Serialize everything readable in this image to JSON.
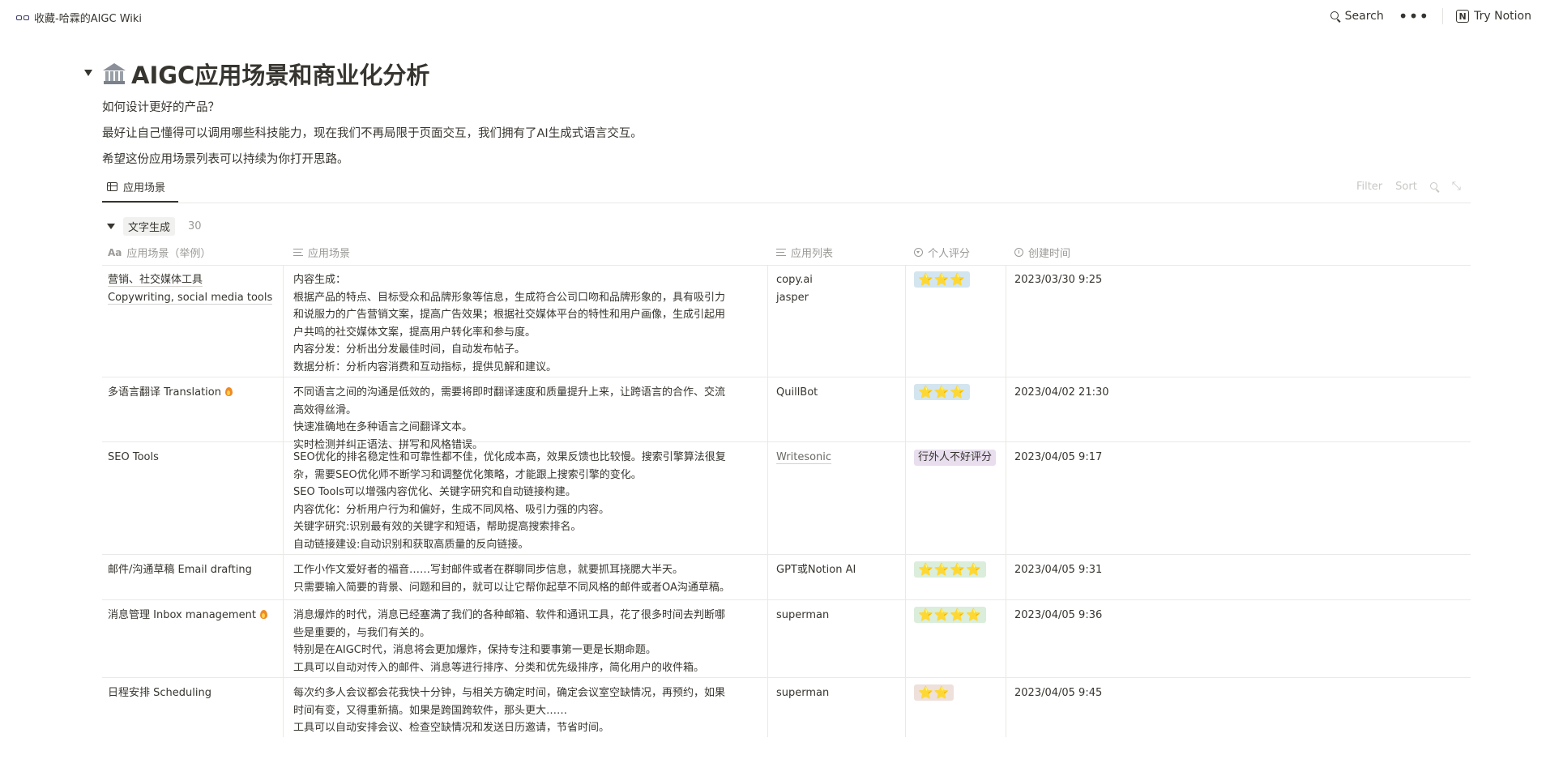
{
  "topbar": {
    "breadcrumb": "收藏-哈霖的AIGC Wiki",
    "search_label": "Search",
    "more_label": "•••",
    "try_label": "Try Notion",
    "notion_logo": "N"
  },
  "page": {
    "title": "AIGC应用场景和商业化分析",
    "desc1": "如何设计更好的产品？",
    "desc2": "最好让自己懂得可以调用哪些科技能力，现在我们不再局限于页面交互，我们拥有了AI生成式语言交互。",
    "desc3": "希望这份应用场景列表可以持续为你打开思路。"
  },
  "view": {
    "tab_label": "应用场景",
    "filter_label": "Filter",
    "sort_label": "Sort"
  },
  "group": {
    "label": "文字生成",
    "count": "30"
  },
  "columns": {
    "c1": "应用场景（举例）",
    "c1_prefix": "Aa",
    "c2": "应用场景",
    "c3": "应用列表",
    "c4": "个人评分",
    "c5": "创建时间"
  },
  "colors": {
    "rating_blue": "#d3e5ef",
    "rating_green": "#dbeddb",
    "rating_purple": "#e8deee",
    "rating_brown": "#eee0da"
  },
  "rows": [
    {
      "name": [
        "营销、社交媒体工具",
        "Copywriting, social media tools"
      ],
      "fire": false,
      "desc": [
        "内容生成：",
        "根据产品的特点、目标受众和品牌形象等信息，生成符合公司口吻和品牌形象的，具有吸引力",
        "和说服力的广告营销文案，提高广告效果；根据社交媒体平台的特性和用户画像，生成引起用",
        "户共鸣的社交媒体文案，提高用户转化率和参与度。",
        "内容分发：分析出分发最佳时间，自动发布帖子。",
        "数据分析：分析内容消费和互动指标，提供见解和建议。"
      ],
      "apps": [
        "copy.ai",
        "jasper"
      ],
      "rating": "⭐⭐⭐",
      "rating_color": "#d3e5ef",
      "created": "2023/03/30 9:25"
    },
    {
      "name": [
        "多语言翻译 Translation"
      ],
      "fire": true,
      "desc": [
        "不同语言之间的沟通是低效的，需要将即时翻译速度和质量提升上来，让跨语言的合作、交流",
        "高效得丝滑。",
        "快速准确地在多种语言之间翻译文本。",
        "实时检测并纠正语法、拼写和风格错误。"
      ],
      "apps": [
        "QuillBot"
      ],
      "rating": "⭐⭐⭐",
      "rating_color": "#d3e5ef",
      "created": "2023/04/02 21:30"
    },
    {
      "name": [
        "SEO Tools"
      ],
      "fire": false,
      "desc": [
        "SEO优化的排名稳定性和可靠性都不佳，优化成本高，效果反馈也比较慢。搜索引擎算法很复",
        "杂，需要SEO优化师不断学习和调整优化策略，才能跟上搜索引擎的变化。",
        "SEO Tools可以增强内容优化、关键字研究和自动链接构建。",
        "内容优化：分析用户行为和偏好，生成不同风格、吸引力强的内容。",
        "关键字研究:识别最有效的关键字和短语，帮助提高搜索排名。",
        "自动链接建设:自动识别和获取高质量的反向链接。"
      ],
      "apps": [
        "Writesonic"
      ],
      "rating": "行外人不好评分",
      "rating_color": "#e8deee",
      "created": "2023/04/05 9:17"
    },
    {
      "name": [
        "邮件/沟通草稿 Email drafting"
      ],
      "fire": false,
      "desc": [
        "工作小作文爱好者的福音……写封邮件或者在群聊同步信息，就要抓耳挠腮大半天。",
        "只需要输入简要的背景、问题和目的，就可以让它帮你起草不同风格的邮件或者OA沟通草稿。"
      ],
      "apps": [
        "GPT或Notion AI"
      ],
      "rating": "⭐⭐⭐⭐",
      "rating_color": "#dbeddb",
      "created": "2023/04/05 9:31"
    },
    {
      "name": [
        "消息管理 Inbox management"
      ],
      "fire": true,
      "desc": [
        "消息爆炸的时代，消息已经塞满了我们的各种邮箱、软件和通讯工具，花了很多时间去判断哪",
        "些是重要的，与我们有关的。",
        "特别是在AIGC时代，消息将会更加爆炸，保持专注和要事第一更是长期命题。",
        "工具可以自动对传入的邮件、消息等进行排序、分类和优先级排序，简化用户的收件箱。"
      ],
      "apps": [
        "superman"
      ],
      "rating": "⭐⭐⭐⭐",
      "rating_color": "#dbeddb",
      "created": "2023/04/05 9:36"
    },
    {
      "name": [
        "日程安排 Scheduling"
      ],
      "fire": false,
      "desc": [
        "每次约多人会议都会花我快十分钟，与相关方确定时间，确定会议室空缺情况，再预约，如果",
        "时间有变，又得重新搞。如果是跨国跨软件，那头更大……",
        "工具可以自动安排会议、检查空缺情况和发送日历邀请，节省时间。"
      ],
      "apps": [
        "superman"
      ],
      "rating": "⭐⭐",
      "rating_color": "#eee0da",
      "created": "2023/04/05 9:45"
    }
  ]
}
